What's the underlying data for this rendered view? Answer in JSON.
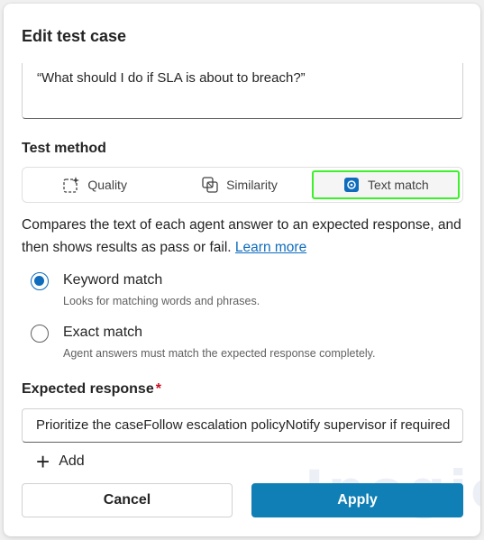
{
  "dialog": {
    "title": "Edit test case",
    "question_text": "“What should I do if SLA is about to breach?”"
  },
  "test_method": {
    "label": "Test method",
    "options": [
      {
        "label": "Quality",
        "icon": "sparkle-frame-icon"
      },
      {
        "label": "Similarity",
        "icon": "overlap-squares-icon"
      },
      {
        "label": "Text match",
        "icon": "text-match-icon"
      }
    ],
    "selected": "Text match",
    "highlight_color": "#3cf02a"
  },
  "description": {
    "text": "Compares the text of each agent answer to an expected response, and then shows results as pass or fail.",
    "link": "Learn more"
  },
  "match_options": [
    {
      "label": "Keyword match",
      "sub": "Looks for matching words and phrases.",
      "checked": true
    },
    {
      "label": "Exact match",
      "sub": "Agent answers must match the expected response completely.",
      "checked": false
    }
  ],
  "expected_response": {
    "label": "Expected response",
    "required_mark": "*",
    "value": "Prioritize the caseFollow escalation policyNotify supervisor if required"
  },
  "add_label": "Add",
  "watermark": "Inogic",
  "buttons": {
    "cancel": "Cancel",
    "apply": "Apply"
  },
  "colors": {
    "accent": "#0f6cbd",
    "apply_bg": "#0f7fb5",
    "required": "#c50f1f"
  }
}
